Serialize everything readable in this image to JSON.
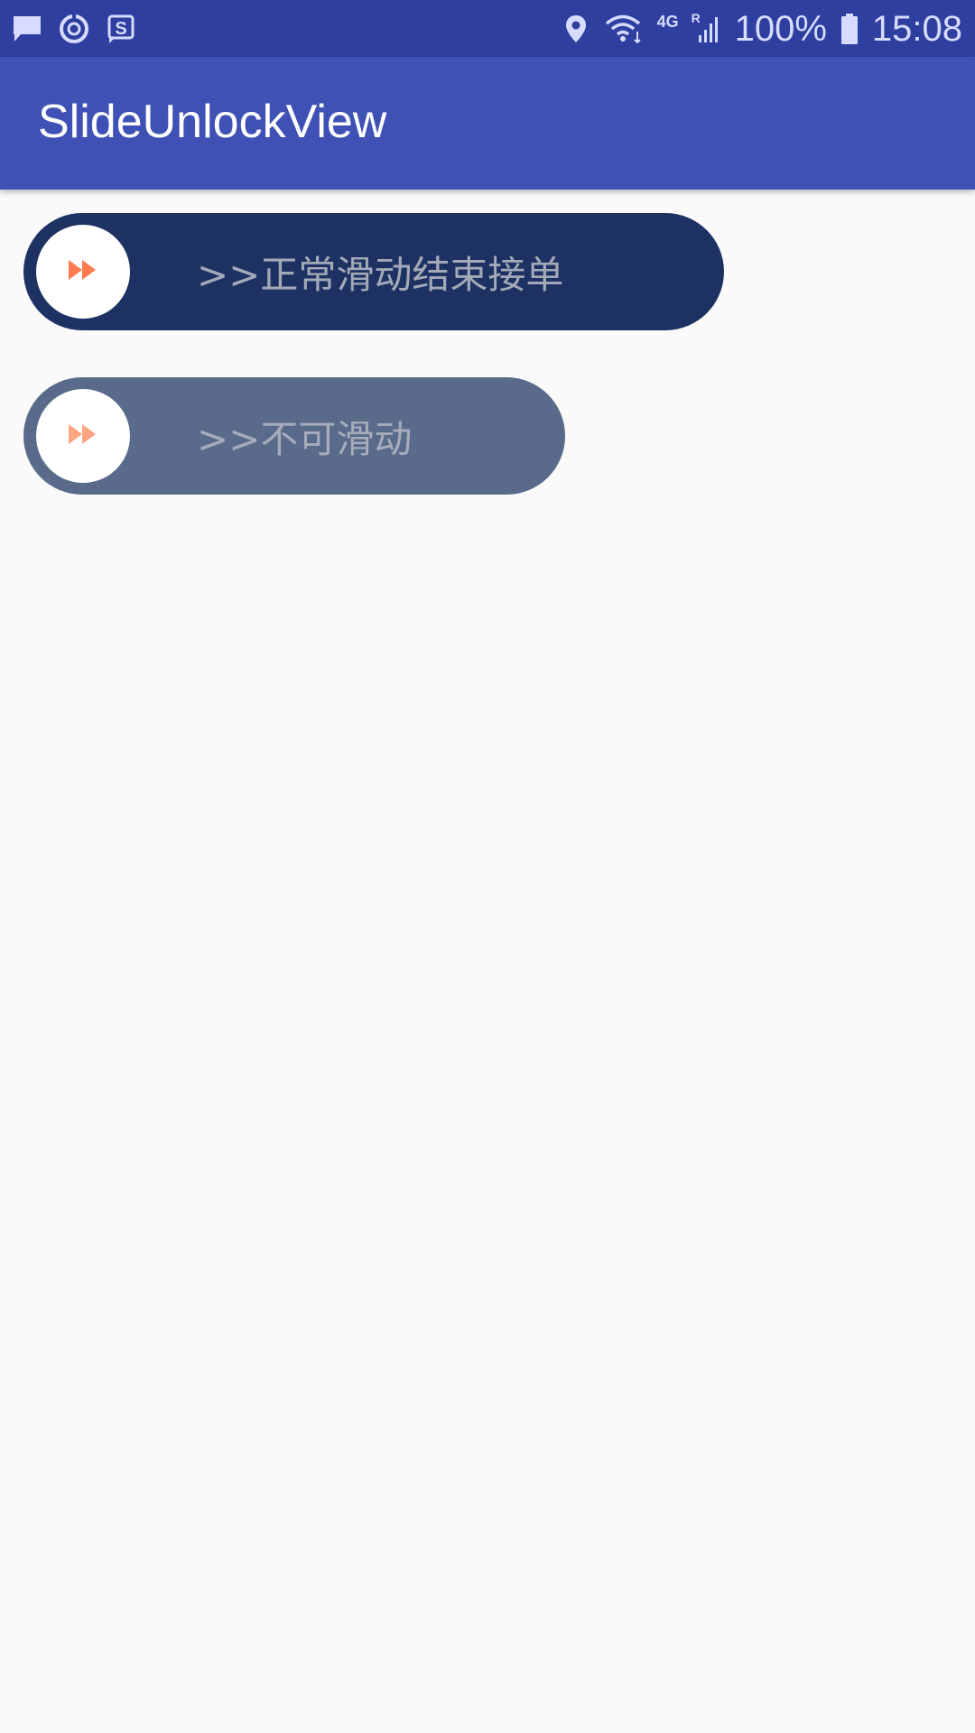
{
  "status_bar": {
    "icons_left": [
      "message-icon",
      "sync-icon",
      "s-app-icon"
    ],
    "icons_right": [
      "location-icon",
      "wifi-icon",
      "network-4g-icon",
      "signal-icon",
      "battery-icon"
    ],
    "network_label": "4G",
    "roaming_label": "R",
    "battery_percent": "100%",
    "time": "15:08"
  },
  "app_bar": {
    "title": "SlideUnlockView"
  },
  "sliders": [
    {
      "label": ">>正常滑动结束接单",
      "enabled": true
    },
    {
      "label": ">>不可滑动",
      "enabled": false
    }
  ],
  "colors": {
    "status_bar": "#2f3fa0",
    "app_bar": "#3f51b5",
    "slider_enabled": "#1d3262",
    "slider_disabled": "#596a8b",
    "arrow_icon": "#ff7a4f",
    "background": "#fafafa"
  }
}
